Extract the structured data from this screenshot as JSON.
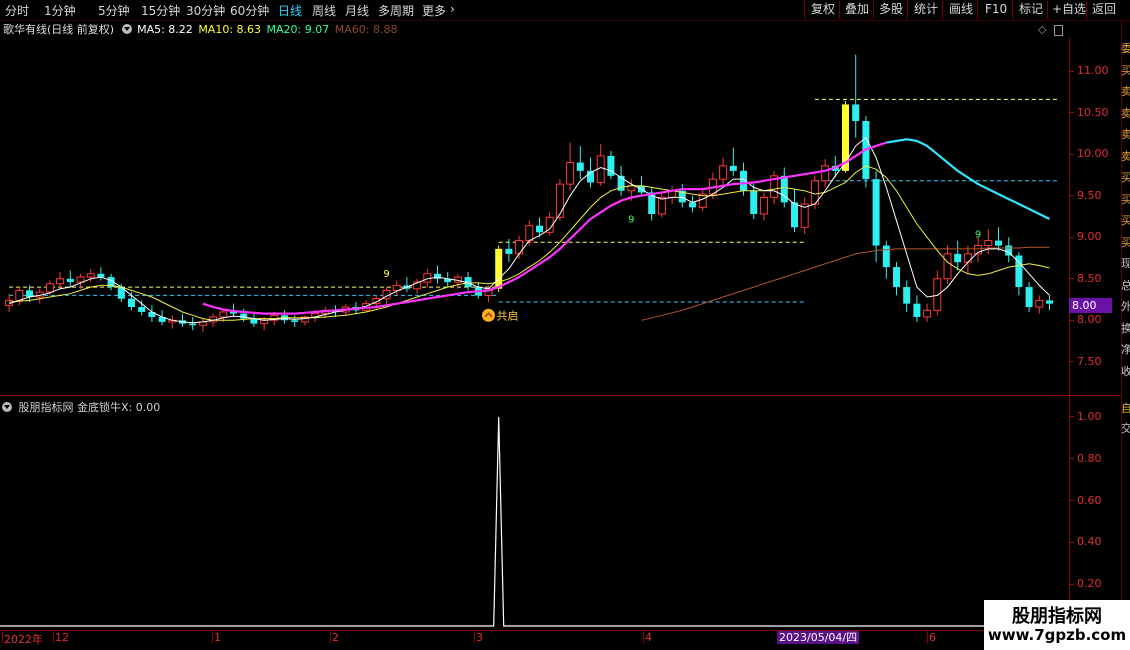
{
  "toolbar": {
    "period_tabs": [
      "分时",
      "1分钟",
      "5分钟",
      "15分钟",
      "30分钟",
      "60分钟",
      "日线",
      "周线",
      "月线",
      "多周期",
      "更多"
    ],
    "active_tab": "日线",
    "right_buttons": [
      "复权",
      "叠加",
      "多股",
      "统计",
      "画线",
      "F10",
      "标记",
      "+自选",
      "返回"
    ]
  },
  "main_legend": {
    "title": "歌华有线(日线 前复权)",
    "ma5": "MA5: 8.22",
    "ma10": "MA10: 8.63",
    "ma20": "MA20: 9.07",
    "ma60": "MA60: 8.88",
    "colors": {
      "ma5": "#ffffff",
      "ma10": "#ffff33",
      "ma20": "#33ff99",
      "ma60": "#ff5a36"
    }
  },
  "price_axis": {
    "ticks": [
      "11.00",
      "10.50",
      "10.00",
      "9.50",
      "9.00",
      "8.50",
      "8.00",
      "7.50"
    ],
    "current_price": "8.00",
    "current_tag_color": "#6a12a8"
  },
  "annotations": {
    "signal_label": "共启",
    "nine_marks": [
      "9",
      "9",
      "9"
    ]
  },
  "side_glyphs": [
    "委",
    "买",
    "卖",
    "卖",
    "卖",
    "卖",
    "买",
    "买",
    "买",
    "买",
    "现",
    "总",
    "外",
    "换",
    "净",
    "收"
  ],
  "indicator": {
    "legend": "股朋指标网 金底锁牛X: 0.00",
    "ticks": [
      "1.00",
      "0.80",
      "0.60",
      "0.40",
      "0.20"
    ],
    "side_glyphs": [
      "自",
      "交"
    ]
  },
  "time_axis": {
    "labels": [
      "2022年",
      "12",
      "1",
      "2",
      "3",
      "4",
      "5",
      "6"
    ],
    "highlight_date": "2023/05/04/四"
  },
  "watermark": {
    "line1": "股朋指标网",
    "line2": "www.7gpzb.com"
  },
  "chart_data": {
    "type": "candlestick",
    "ohlc": [
      [
        8.18,
        8.32,
        8.1,
        8.24
      ],
      [
        8.24,
        8.4,
        8.18,
        8.36
      ],
      [
        8.36,
        8.42,
        8.22,
        8.28
      ],
      [
        8.28,
        8.38,
        8.2,
        8.34
      ],
      [
        8.34,
        8.48,
        8.3,
        8.44
      ],
      [
        8.44,
        8.58,
        8.38,
        8.5
      ],
      [
        8.5,
        8.6,
        8.4,
        8.46
      ],
      [
        8.46,
        8.56,
        8.38,
        8.52
      ],
      [
        8.52,
        8.62,
        8.46,
        8.56
      ],
      [
        8.56,
        8.64,
        8.48,
        8.52
      ],
      [
        8.52,
        8.56,
        8.36,
        8.4
      ],
      [
        8.4,
        8.44,
        8.22,
        8.26
      ],
      [
        8.26,
        8.34,
        8.12,
        8.16
      ],
      [
        8.16,
        8.24,
        8.06,
        8.1
      ],
      [
        8.1,
        8.18,
        7.98,
        8.04
      ],
      [
        8.04,
        8.12,
        7.94,
        7.98
      ],
      [
        7.98,
        8.06,
        7.9,
        8.0
      ],
      [
        8.0,
        8.08,
        7.92,
        7.96
      ],
      [
        7.96,
        8.04,
        7.88,
        7.94
      ],
      [
        7.94,
        8.02,
        7.86,
        7.98
      ],
      [
        7.98,
        8.08,
        7.92,
        8.04
      ],
      [
        8.04,
        8.14,
        7.98,
        8.1
      ],
      [
        8.1,
        8.2,
        8.04,
        8.08
      ],
      [
        8.08,
        8.14,
        7.98,
        8.02
      ],
      [
        8.02,
        8.1,
        7.92,
        7.96
      ],
      [
        7.96,
        8.04,
        7.88,
        8.0
      ],
      [
        8.0,
        8.1,
        7.94,
        8.06
      ],
      [
        8.06,
        8.12,
        7.96,
        8.0
      ],
      [
        8.0,
        8.06,
        7.92,
        7.98
      ],
      [
        7.98,
        8.06,
        7.94,
        8.04
      ],
      [
        8.04,
        8.12,
        7.98,
        8.08
      ],
      [
        8.08,
        8.16,
        8.02,
        8.12
      ],
      [
        8.12,
        8.18,
        8.04,
        8.1
      ],
      [
        8.1,
        8.2,
        8.06,
        8.16
      ],
      [
        8.16,
        8.22,
        8.08,
        8.12
      ],
      [
        8.12,
        8.24,
        8.1,
        8.2
      ],
      [
        8.2,
        8.3,
        8.14,
        8.26
      ],
      [
        8.26,
        8.4,
        8.2,
        8.36
      ],
      [
        8.36,
        8.48,
        8.3,
        8.42
      ],
      [
        8.42,
        8.52,
        8.34,
        8.38
      ],
      [
        8.38,
        8.5,
        8.32,
        8.46
      ],
      [
        8.46,
        8.62,
        8.4,
        8.56
      ],
      [
        8.56,
        8.66,
        8.44,
        8.5
      ],
      [
        8.5,
        8.58,
        8.4,
        8.46
      ],
      [
        8.46,
        8.56,
        8.38,
        8.52
      ],
      [
        8.52,
        8.58,
        8.36,
        8.4
      ],
      [
        8.4,
        8.46,
        8.26,
        8.3
      ],
      [
        8.3,
        8.42,
        8.22,
        8.38
      ],
      [
        8.38,
        8.9,
        8.34,
        8.86
      ],
      [
        8.86,
        8.98,
        8.7,
        8.8
      ],
      [
        8.8,
        9.02,
        8.74,
        8.96
      ],
      [
        8.96,
        9.2,
        8.9,
        9.14
      ],
      [
        9.14,
        9.24,
        9.0,
        9.06
      ],
      [
        9.06,
        9.3,
        9.02,
        9.24
      ],
      [
        9.24,
        9.7,
        9.2,
        9.64
      ],
      [
        9.64,
        10.14,
        9.56,
        9.9
      ],
      [
        9.9,
        10.1,
        9.7,
        9.8
      ],
      [
        9.8,
        9.96,
        9.6,
        9.66
      ],
      [
        9.66,
        10.12,
        9.62,
        9.98
      ],
      [
        9.98,
        10.04,
        9.7,
        9.74
      ],
      [
        9.74,
        9.86,
        9.5,
        9.56
      ],
      [
        9.56,
        9.7,
        9.44,
        9.62
      ],
      [
        9.62,
        9.74,
        9.5,
        9.54
      ],
      [
        9.54,
        9.6,
        9.2,
        9.28
      ],
      [
        9.28,
        9.54,
        9.24,
        9.48
      ],
      [
        9.48,
        9.62,
        9.4,
        9.56
      ],
      [
        9.56,
        9.64,
        9.36,
        9.42
      ],
      [
        9.42,
        9.5,
        9.3,
        9.36
      ],
      [
        9.36,
        9.6,
        9.32,
        9.52
      ],
      [
        9.52,
        9.78,
        9.46,
        9.7
      ],
      [
        9.7,
        9.96,
        9.62,
        9.86
      ],
      [
        9.86,
        10.08,
        9.74,
        9.8
      ],
      [
        9.8,
        9.9,
        9.5,
        9.56
      ],
      [
        9.56,
        9.64,
        9.22,
        9.28
      ],
      [
        9.28,
        9.54,
        9.2,
        9.48
      ],
      [
        9.48,
        9.8,
        9.4,
        9.74
      ],
      [
        9.74,
        9.84,
        9.36,
        9.42
      ],
      [
        9.42,
        9.58,
        9.06,
        9.12
      ],
      [
        9.12,
        9.48,
        9.04,
        9.4
      ],
      [
        9.4,
        9.74,
        9.34,
        9.68
      ],
      [
        9.68,
        9.94,
        9.6,
        9.86
      ],
      [
        9.86,
        9.98,
        9.72,
        9.8
      ],
      [
        9.8,
        10.64,
        9.78,
        10.6
      ],
      [
        10.6,
        11.2,
        10.2,
        10.4
      ],
      [
        10.4,
        10.46,
        9.6,
        9.7
      ],
      [
        9.7,
        9.8,
        8.7,
        8.9
      ],
      [
        8.9,
        8.96,
        8.5,
        8.64
      ],
      [
        8.64,
        8.7,
        8.3,
        8.4
      ],
      [
        8.4,
        8.48,
        8.1,
        8.2
      ],
      [
        8.2,
        8.3,
        7.98,
        8.04
      ],
      [
        8.04,
        8.2,
        7.98,
        8.12
      ],
      [
        8.12,
        8.6,
        8.06,
        8.5
      ],
      [
        8.5,
        8.9,
        8.44,
        8.8
      ],
      [
        8.8,
        8.96,
        8.6,
        8.7
      ],
      [
        8.7,
        8.9,
        8.56,
        8.8
      ],
      [
        8.8,
        9.0,
        8.7,
        8.9
      ],
      [
        8.9,
        9.1,
        8.8,
        8.96
      ],
      [
        8.96,
        9.12,
        8.84,
        8.9
      ],
      [
        8.9,
        9.0,
        8.7,
        8.78
      ],
      [
        8.78,
        8.82,
        8.3,
        8.4
      ],
      [
        8.4,
        8.46,
        8.1,
        8.16
      ],
      [
        8.16,
        8.3,
        8.08,
        8.24
      ],
      [
        8.24,
        8.3,
        8.12,
        8.2
      ]
    ],
    "ma5": [
      8.2,
      8.24,
      8.28,
      8.3,
      8.33,
      8.38,
      8.4,
      8.45,
      8.5,
      8.52,
      8.48,
      8.4,
      8.3,
      8.2,
      8.1,
      8.04,
      8.0,
      7.98,
      7.97,
      7.98,
      8.0,
      8.03,
      8.05,
      8.04,
      8.02,
      8.0,
      8.01,
      8.02,
      8.01,
      8.02,
      8.04,
      8.07,
      8.1,
      8.12,
      8.14,
      8.17,
      8.22,
      8.29,
      8.35,
      8.4,
      8.45,
      8.5,
      8.52,
      8.5,
      8.48,
      8.45,
      8.4,
      8.38,
      8.5,
      8.62,
      8.8,
      8.96,
      9.02,
      9.1,
      9.28,
      9.5,
      9.68,
      9.78,
      9.84,
      9.8,
      9.72,
      9.64,
      9.58,
      9.5,
      9.46,
      9.48,
      9.48,
      9.42,
      9.46,
      9.52,
      9.6,
      9.7,
      9.7,
      9.6,
      9.56,
      9.56,
      9.5,
      9.4,
      9.36,
      9.4,
      9.56,
      9.74,
      9.9,
      10.1,
      10.2,
      9.96,
      9.6,
      9.2,
      8.8,
      8.4,
      8.28,
      8.3,
      8.4,
      8.56,
      8.7,
      8.82,
      8.86,
      8.86,
      8.82,
      8.7,
      8.56,
      8.42,
      8.3
    ],
    "ma10": [
      8.22,
      8.23,
      8.24,
      8.26,
      8.28,
      8.3,
      8.32,
      8.36,
      8.4,
      8.42,
      8.42,
      8.4,
      8.36,
      8.32,
      8.28,
      8.22,
      8.16,
      8.1,
      8.06,
      8.02,
      8.0,
      8.0,
      8.0,
      8.01,
      8.02,
      8.02,
      8.02,
      8.03,
      8.03,
      8.03,
      8.03,
      8.04,
      8.05,
      8.06,
      8.08,
      8.1,
      8.13,
      8.16,
      8.2,
      8.24,
      8.28,
      8.32,
      8.36,
      8.4,
      8.43,
      8.45,
      8.45,
      8.44,
      8.46,
      8.5,
      8.56,
      8.64,
      8.72,
      8.82,
      8.94,
      9.08,
      9.22,
      9.36,
      9.48,
      9.56,
      9.6,
      9.62,
      9.62,
      9.6,
      9.58,
      9.56,
      9.54,
      9.52,
      9.5,
      9.5,
      9.52,
      9.54,
      9.56,
      9.56,
      9.56,
      9.58,
      9.6,
      9.58,
      9.56,
      9.52,
      9.54,
      9.6,
      9.66,
      9.78,
      9.86,
      9.82,
      9.72,
      9.56,
      9.36,
      9.16,
      9.0,
      8.84,
      8.7,
      8.62,
      8.56,
      8.54,
      8.56,
      8.6,
      8.64,
      8.66,
      8.68,
      8.66,
      8.63
    ],
    "ma20": [
      null,
      null,
      null,
      null,
      null,
      null,
      null,
      null,
      null,
      null,
      null,
      null,
      null,
      null,
      null,
      null,
      null,
      null,
      null,
      8.2,
      8.16,
      8.13,
      8.11,
      8.1,
      8.09,
      8.08,
      8.08,
      8.08,
      8.08,
      8.09,
      8.1,
      8.11,
      8.12,
      8.13,
      8.14,
      8.15,
      8.16,
      8.18,
      8.2,
      8.22,
      8.24,
      8.26,
      8.28,
      8.3,
      8.32,
      8.34,
      8.35,
      8.36,
      8.4,
      8.46,
      8.52,
      8.6,
      8.68,
      8.76,
      8.86,
      8.98,
      9.1,
      9.22,
      9.3,
      9.38,
      9.44,
      9.48,
      9.5,
      9.52,
      9.54,
      9.56,
      9.58,
      9.58,
      9.58,
      9.6,
      9.62,
      9.64,
      9.65,
      9.66,
      9.68,
      9.7,
      9.72,
      9.74,
      9.76,
      9.78,
      9.8,
      9.84,
      9.9,
      9.98,
      10.06,
      10.1,
      10.14,
      10.16,
      10.18,
      10.16,
      10.1,
      10.0,
      9.9,
      9.8,
      9.72,
      9.64,
      9.58,
      9.52,
      9.46,
      9.4,
      9.34,
      9.28,
      9.22
    ],
    "ma60": [
      null,
      null,
      null,
      null,
      null,
      null,
      null,
      null,
      null,
      null,
      null,
      null,
      null,
      null,
      null,
      null,
      null,
      null,
      null,
      null,
      null,
      null,
      null,
      null,
      null,
      null,
      null,
      null,
      null,
      null,
      null,
      null,
      null,
      null,
      null,
      null,
      null,
      null,
      null,
      null,
      null,
      null,
      null,
      null,
      null,
      null,
      null,
      null,
      null,
      null,
      null,
      null,
      null,
      null,
      null,
      null,
      null,
      null,
      null,
      null,
      null,
      null,
      8.0,
      8.03,
      8.06,
      8.09,
      8.12,
      8.16,
      8.2,
      8.24,
      8.28,
      8.32,
      8.36,
      8.4,
      8.44,
      8.48,
      8.52,
      8.56,
      8.6,
      8.64,
      8.68,
      8.72,
      8.76,
      8.8,
      8.82,
      8.84,
      8.85,
      8.86,
      8.86,
      8.86,
      8.86,
      8.86,
      8.86,
      8.86,
      8.86,
      8.86,
      8.87,
      8.87,
      8.87,
      8.87,
      8.88,
      8.88,
      8.88
    ],
    "ylim": [
      7.1,
      11.4
    ],
    "indicator_series": {
      "spike_index": 48,
      "spike_value": 1.0,
      "ylim": [
        0,
        1.1
      ]
    },
    "h_lines": [
      {
        "value": 10.66,
        "color": "#ffff66",
        "from": 79,
        "to": 103
      },
      {
        "value": 9.68,
        "color": "#33ccff",
        "from": 79,
        "to": 103
      },
      {
        "value": 8.94,
        "color": "#ffff66",
        "from": 48,
        "to": 78
      },
      {
        "value": 8.22,
        "color": "#33ccff",
        "from": 48,
        "to": 78
      },
      {
        "value": 8.4,
        "color": "#ffff66",
        "from": 0,
        "to": 48
      },
      {
        "value": 8.3,
        "color": "#33ccff",
        "from": 0,
        "to": 48
      }
    ]
  }
}
